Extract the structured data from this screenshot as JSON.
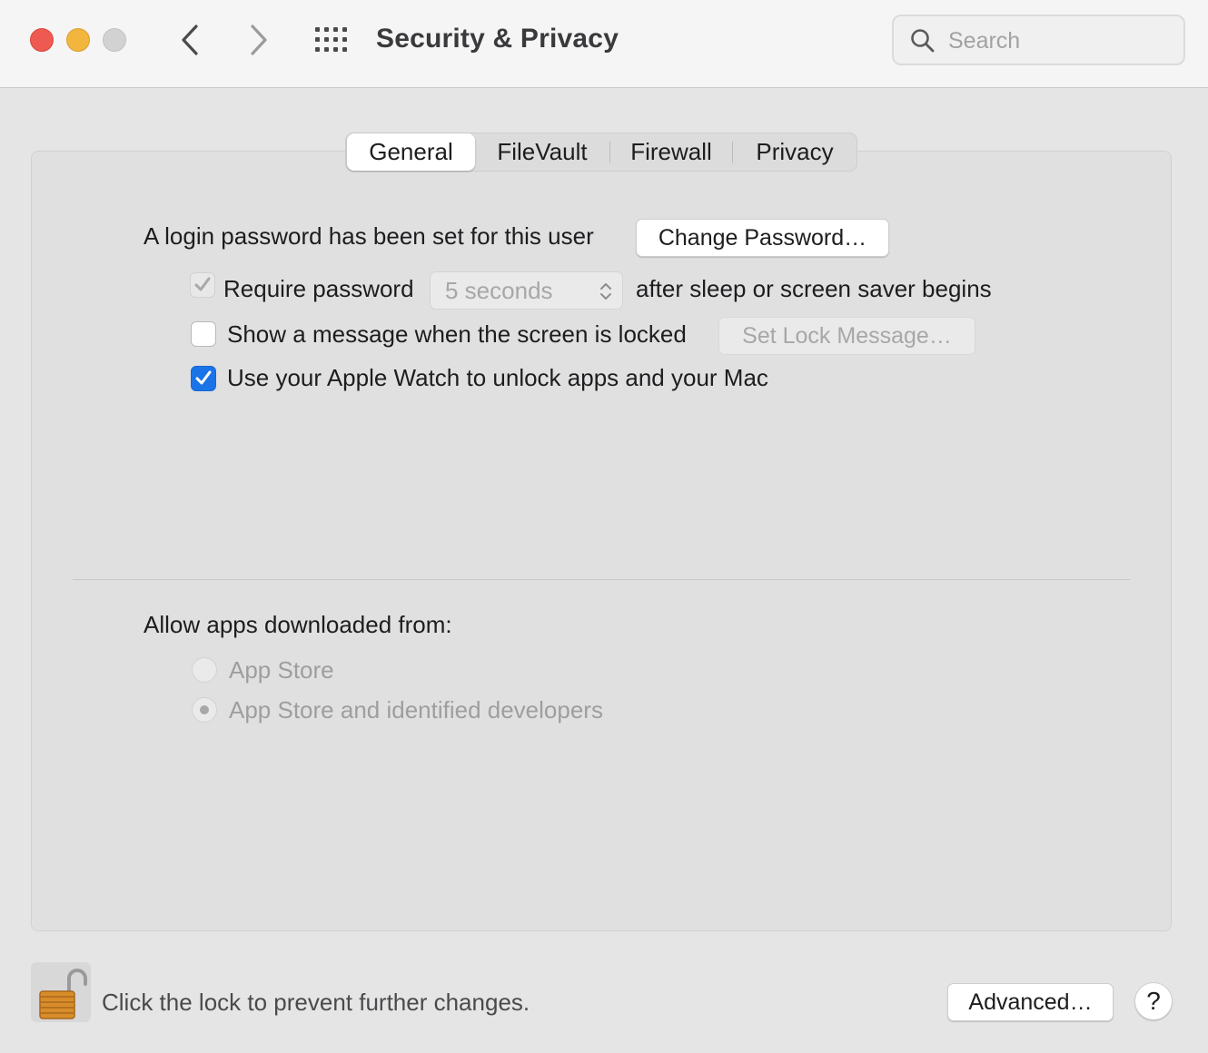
{
  "window": {
    "title": "Security & Privacy"
  },
  "search": {
    "placeholder": "Search"
  },
  "tabs": [
    {
      "label": "General",
      "active": true
    },
    {
      "label": "FileVault",
      "active": false
    },
    {
      "label": "Firewall",
      "active": false
    },
    {
      "label": "Privacy",
      "active": false
    }
  ],
  "general": {
    "login_text": "A login password has been set for this user",
    "change_password_label": "Change Password…",
    "require_password": {
      "label": "Require password",
      "checked": true,
      "enabled": false,
      "delay_value": "5 seconds",
      "suffix": "after sleep or screen saver begins"
    },
    "show_message": {
      "label": "Show a message when the screen is locked",
      "checked": false,
      "button_label": "Set Lock Message…"
    },
    "apple_watch": {
      "label": "Use your Apple Watch to unlock apps and your Mac",
      "checked": true
    }
  },
  "downloads": {
    "heading": "Allow apps downloaded from:",
    "options": [
      {
        "label": "App Store",
        "selected": false
      },
      {
        "label": "App Store and identified developers",
        "selected": true
      }
    ]
  },
  "footer": {
    "lock_text": "Click the lock to prevent further changes.",
    "advanced_label": "Advanced…",
    "help_label": "?"
  },
  "colors": {
    "accent": "#1a74e8",
    "close": "#ee5a52",
    "minimize": "#f2b53d",
    "zoom_disabled": "#d3d2d3"
  },
  "icons": {
    "back": "chevron-left-icon",
    "forward": "chevron-right-icon",
    "show_all": "grid-icon",
    "search": "search-icon",
    "lock": "open-padlock-icon",
    "help": "question-icon"
  }
}
